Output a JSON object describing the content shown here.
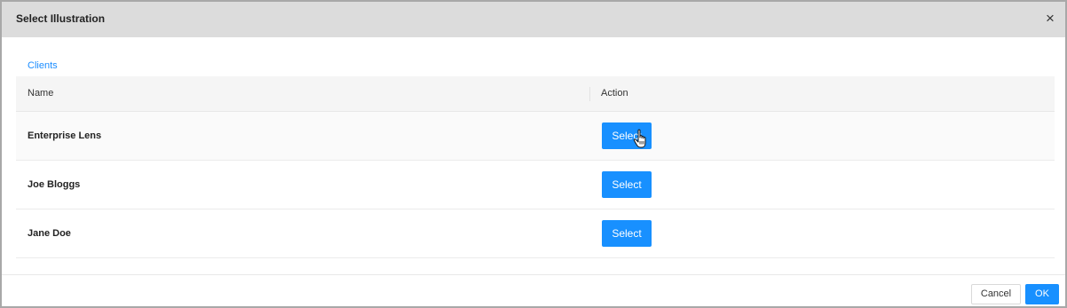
{
  "dialog": {
    "title": "Select Illustration",
    "close_icon": "close-icon",
    "close_glyph": "×"
  },
  "breadcrumb": {
    "label": "Clients"
  },
  "table": {
    "columns": [
      "Name",
      "Action"
    ],
    "rows": [
      {
        "name": "Enterprise Lens",
        "action_label": "Select"
      },
      {
        "name": "Joe Bloggs",
        "action_label": "Select"
      },
      {
        "name": "Jane Doe",
        "action_label": "Select"
      }
    ]
  },
  "footer": {
    "cancel_label": "Cancel",
    "ok_label": "OK"
  },
  "colors": {
    "accent": "#1890ff",
    "header_bg": "#dcdcdc",
    "link": "#1a8cff"
  },
  "cursor_icon": "hand-pointer-icon"
}
